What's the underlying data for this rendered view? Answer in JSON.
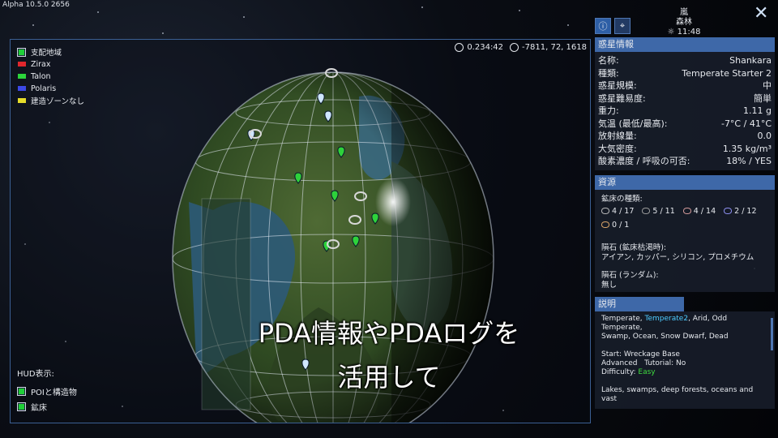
{
  "version": "Alpha 10.5.0 2656",
  "weather": {
    "line1": "嵐",
    "line2": "森林",
    "time": "11:48"
  },
  "close_label": "✕",
  "map": {
    "legend_title": "支配地域",
    "factions": [
      {
        "name": "Zirax",
        "color": "#e0272d"
      },
      {
        "name": "Talon",
        "color": "#2cd43b"
      },
      {
        "name": "Polaris",
        "color": "#3c49e6"
      },
      {
        "name": "建造ゾーンなし",
        "color": "#e6dc2a"
      }
    ],
    "time_readout": "0.234:42",
    "coord_readout": "-7811, 72, 1618",
    "hud_title": "HUD表示:",
    "hud_items": [
      "POIと構造物",
      "鉱床"
    ]
  },
  "planet": {
    "header": "惑星情報",
    "rows": [
      {
        "label": "名称:",
        "value": "Shankara"
      },
      {
        "label": "種類:",
        "value": "Temperate Starter 2"
      },
      {
        "label": "惑星規模:",
        "value": "中"
      },
      {
        "label": "惑星難易度:",
        "value": "簡単"
      },
      {
        "label": "重力:",
        "value": "1.11 g"
      },
      {
        "label": "気温 (最低/最高):",
        "value": "-7°C / 41°C"
      },
      {
        "label": "放射線量:",
        "value": "0.0"
      },
      {
        "label": "大気密度:",
        "value": "1.35 kg/m³"
      },
      {
        "label": "酸素濃度 / 呼吸の可否:",
        "value": "18% / YES"
      }
    ]
  },
  "resources": {
    "header": "資源",
    "ore_title": "鉱床の種類:",
    "ores": [
      {
        "count": "4 / 17",
        "color": "#b9b9b9"
      },
      {
        "count": "5 / 11",
        "color": "#9a9a9a"
      },
      {
        "count": "4 / 14",
        "color": "#d39a9a"
      },
      {
        "count": "2 / 12",
        "color": "#8d8ff0"
      },
      {
        "count": "0 / 1",
        "color": "#d9a46a"
      }
    ],
    "meteor_title": "隕石 (鉱床枯渇時):",
    "meteor_list": "アイアン, カッパー, シリコン, プロメチウム",
    "random_title": "隕石 (ランダム):",
    "random_value": "無し"
  },
  "description": {
    "header": "説明",
    "line1a": "Temperate, ",
    "line1b": "Temperate2",
    "line1c": ", Arid, Odd Temperate,",
    "line2": "Swamp, Ocean, Snow Dwarf, Dead",
    "start": "Start: Wreckage Base",
    "advanced": "Advanced",
    "tutorial": "Tutorial: No",
    "difficulty_label": "Difficulty: ",
    "difficulty_value": "Easy",
    "last": "Lakes, swamps, deep forests, oceans and vast"
  },
  "captions": {
    "line1": "PDA情報やPDAログを",
    "line2": "活用して"
  }
}
